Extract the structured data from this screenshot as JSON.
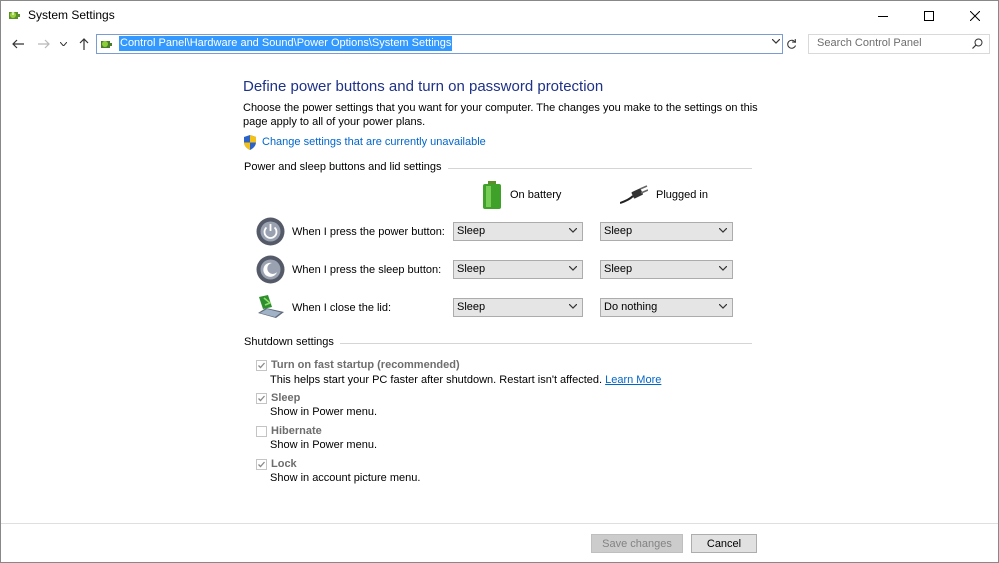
{
  "window": {
    "title": "System Settings",
    "minimize_icon": "minimize-icon",
    "maximize_icon": "maximize-icon",
    "close_icon": "close-icon"
  },
  "navigation": {
    "address_path": "Control Panel\\Hardware and Sound\\Power Options\\System Settings",
    "search_placeholder": "Search Control Panel"
  },
  "content": {
    "heading": "Define power buttons and turn on password protection",
    "description": "Choose the power settings that you want for your computer. The changes you make to the settings on this page apply to all of your power plans.",
    "change_link": "Change settings that are currently unavailable",
    "buttons_section": {
      "title": "Power and sleep buttons and lid settings",
      "columns": {
        "battery": "On battery",
        "plugged": "Plugged in"
      },
      "rows": [
        {
          "label": "When I press the power button:",
          "battery": "Sleep",
          "plugged": "Sleep"
        },
        {
          "label": "When I press the sleep button:",
          "battery": "Sleep",
          "plugged": "Sleep"
        },
        {
          "label": "When I close the lid:",
          "battery": "Sleep",
          "plugged": "Do nothing"
        }
      ]
    },
    "shutdown_section": {
      "title": "Shutdown settings",
      "items": [
        {
          "label": "Turn on fast startup (recommended)",
          "checked": true,
          "desc": "This helps start your PC faster after shutdown. Restart isn't affected.",
          "link": "Learn More"
        },
        {
          "label": "Sleep",
          "checked": true,
          "desc": "Show in Power menu."
        },
        {
          "label": "Hibernate",
          "checked": false,
          "desc": "Show in Power menu."
        },
        {
          "label": "Lock",
          "checked": true,
          "desc": "Show in account picture menu."
        }
      ]
    }
  },
  "footer": {
    "save_label": "Save changes",
    "cancel_label": "Cancel"
  },
  "colors": {
    "heading": "#1e3287",
    "link": "#0066cc",
    "selection": "#3399ff"
  }
}
